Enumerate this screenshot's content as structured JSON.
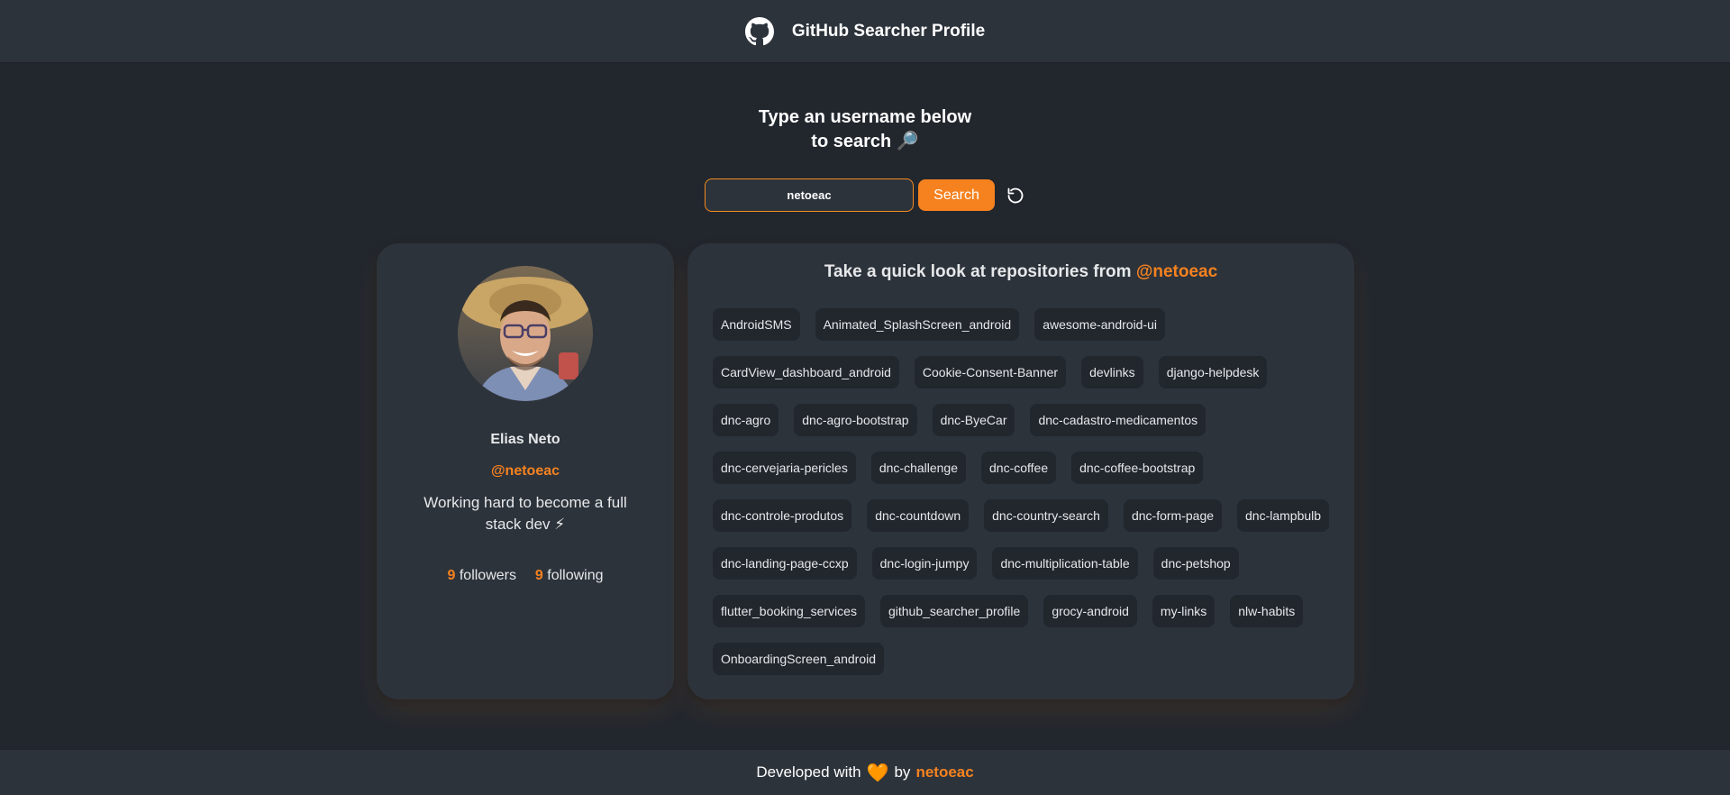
{
  "header": {
    "title": "GitHub Searcher Profile",
    "logo_icon": "github-icon"
  },
  "prompt": {
    "line1": "Type an username below",
    "line2": "to search",
    "emoji": "🔎"
  },
  "search": {
    "value": "netoeac",
    "placeholder": "",
    "button_label": "Search",
    "reset_icon": "refresh-icon"
  },
  "profile": {
    "name": "Elias Neto",
    "login": "@netoeac",
    "bio": "Working hard to become a full stack dev ⚡",
    "followers_count": "9",
    "followers_label": "followers",
    "following_count": "9",
    "following_label": "following"
  },
  "repos": {
    "title_prefix": "Take a quick look at repositories from",
    "title_user": "@netoeac",
    "items": [
      "AndroidSMS",
      "Animated_SplashScreen_android",
      "awesome-android-ui",
      "CardView_dashboard_android",
      "Cookie-Consent-Banner",
      "devlinks",
      "django-helpdesk",
      "dnc-agro",
      "dnc-agro-bootstrap",
      "dnc-ByeCar",
      "dnc-cadastro-medicamentos",
      "dnc-cervejaria-pericles",
      "dnc-challenge",
      "dnc-coffee",
      "dnc-coffee-bootstrap",
      "dnc-controle-produtos",
      "dnc-countdown",
      "dnc-country-search",
      "dnc-form-page",
      "dnc-lampbulb",
      "dnc-landing-page-ccxp",
      "dnc-login-jumpy",
      "dnc-multiplication-table",
      "dnc-petshop",
      "flutter_booking_services",
      "github_searcher_profile",
      "grocy-android",
      "my-links",
      "nlw-habits",
      "OnboardingScreen_android"
    ]
  },
  "footer": {
    "prefix": "Developed with",
    "heart": "🧡",
    "by": "by",
    "author": "netoeac"
  },
  "colors": {
    "accent": "#f6821f",
    "background": "#22272e",
    "surface": "#2d333b"
  }
}
